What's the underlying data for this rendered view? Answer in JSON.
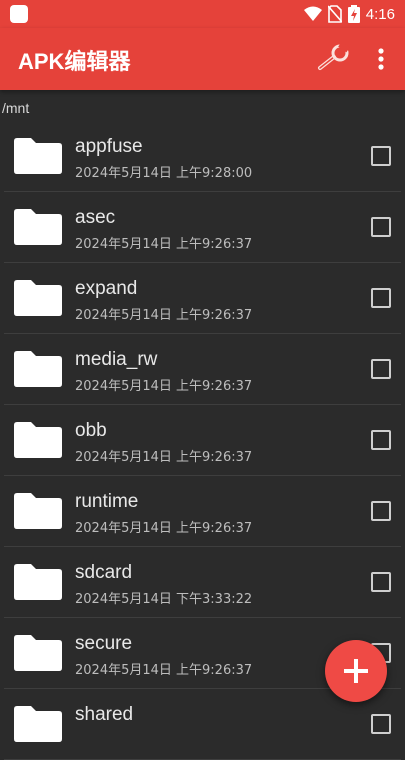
{
  "status_bar": {
    "time": "4:16",
    "icons": [
      "app-notification-icon",
      "wifi-icon",
      "no-sim-icon",
      "battery-charging-icon"
    ]
  },
  "app_bar": {
    "title": "APK编辑器",
    "actions": [
      "wrench-icon",
      "more-vert-icon"
    ]
  },
  "current_path": "/mnt",
  "files": [
    {
      "name": "appfuse",
      "date": "2024年5月14日 上午9:28:00"
    },
    {
      "name": "asec",
      "date": "2024年5月14日 上午9:26:37"
    },
    {
      "name": "expand",
      "date": "2024年5月14日 上午9:26:37"
    },
    {
      "name": "media_rw",
      "date": "2024年5月14日 上午9:26:37"
    },
    {
      "name": "obb",
      "date": "2024年5月14日 上午9:26:37"
    },
    {
      "name": "runtime",
      "date": "2024年5月14日 上午9:26:37"
    },
    {
      "name": "sdcard",
      "date": "2024年5月14日 下午3:33:22"
    },
    {
      "name": "secure",
      "date": "2024年5月14日 上午9:26:37"
    },
    {
      "name": "shared",
      "date": ""
    }
  ],
  "fab": {
    "icon": "plus-icon"
  },
  "colors": {
    "accent": "#e5423a",
    "background": "#2b2b2b",
    "fab": "#ef4a45"
  }
}
